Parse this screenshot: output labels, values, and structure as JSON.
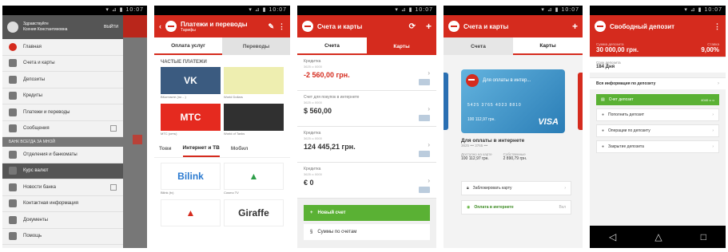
{
  "screen1": {
    "status": "▾ ⊿ ▮ 10:07",
    "profile": {
      "greeting": "Здравствуйте",
      "name": "Ксения Константиновна",
      "menu_label": "ВЫЙТИ"
    },
    "items": [
      {
        "icon": "bank-logo-icon",
        "label": "Главная"
      },
      {
        "icon": "cards-icon",
        "label": "Счета и карты"
      },
      {
        "icon": "deposits-icon",
        "label": "Депозиты"
      },
      {
        "icon": "credits-icon",
        "label": "Кредиты"
      },
      {
        "icon": "payments-icon",
        "label": "Платежи и переводы"
      },
      {
        "icon": "messages-icon",
        "label": "Сообщения"
      }
    ],
    "section": "БАНК ВСЕГДА ЗА МНОЙ",
    "items2": [
      {
        "icon": "branches-icon",
        "label": "Отделения и банкоматы"
      },
      {
        "icon": "exchange-icon",
        "label": "Курс валют"
      },
      {
        "icon": "news-icon",
        "label": "Новости банка"
      },
      {
        "icon": "info-icon",
        "label": "Контактная информация"
      },
      {
        "icon": "docs-icon",
        "label": "Документы"
      },
      {
        "icon": "help-icon",
        "label": "Помощь"
      }
    ]
  },
  "screen2": {
    "status": "▾ ⊿ ▮ 10:07",
    "title": "Платежи и переводы",
    "subtitle": "Тарифы",
    "tabs": [
      "Оплата услуг",
      "Переводы"
    ],
    "section": "ЧАСТЫЕ ПЛАТЕЖИ",
    "tiles": [
      {
        "label": "VK",
        "caption": "ВКонтакте (по ...)",
        "color": "#3b5b80",
        "fg": "#ffffff"
      },
      {
        "label": "",
        "caption": "World Dollars",
        "color": "#eeeeb0",
        "fg": "#666600"
      },
      {
        "label": "МТС",
        "caption": "МТС (сеть)",
        "color": "#e52a1f",
        "fg": "#ffffff"
      },
      {
        "label": "",
        "caption": "World of Tanks",
        "color": "#303030",
        "fg": "#cccccc"
      }
    ],
    "cat_tabs": [
      "Тови",
      "Интернет и ТВ",
      "Мобил"
    ],
    "providers": [
      {
        "label": "Bilink",
        "caption": "Bilink (tv)",
        "color": "#ffffff",
        "fg": "#2b7ad0"
      },
      {
        "label": "▲",
        "caption": "Cosmo TV",
        "color": "#ffffff",
        "fg": "#2e9e49"
      },
      {
        "label": "▲",
        "caption": "",
        "color": "#ffffff",
        "fg": "#d52b1e"
      },
      {
        "label": "Giraffe",
        "caption": "",
        "color": "#ffffff",
        "fg": "#333333"
      }
    ]
  },
  "screen3": {
    "status": "▾ ⊿ ▮ 10:07",
    "title": "Счета и карты",
    "tabs": [
      "Счета",
      "Карты"
    ],
    "accounts": [
      {
        "label": "Кредитка",
        "sub": "3625 •• 0000",
        "value": "-2 560,00 грн.",
        "neg": true
      },
      {
        "label": "Счет для покупок в интернете",
        "sub": "3625 •• 0000",
        "value": "$ 560,00",
        "neg": false
      },
      {
        "label": "Кредитка",
        "sub": "3625 •• 0000",
        "value": "124 445,21 грн.",
        "neg": false
      },
      {
        "label": "Кредитка",
        "sub": "3625 •• 0000",
        "value": "€ 0",
        "neg": false
      }
    ],
    "new_btn": "Новый счет",
    "link": "Суммы по счетам"
  },
  "screen4": {
    "status": "▾ ⊿ ▮ 10:07",
    "title": "Счета и карты",
    "tabs": [
      "Счета",
      "Карты"
    ],
    "card_title": "Для оплаты в интер...",
    "card_number": "5425  3765  4023  8810",
    "card_sub": "100 112,97 грн.",
    "brand": "VISA",
    "name": "Для оплаты в интернете",
    "name_sub": "3625 ••• 3765 •••",
    "left_k": "Доступно на карте",
    "left_v": "100 112,97 грн.",
    "right_k": "Собственные",
    "right_v": "2 890,79 грн.",
    "lock_btn": "Заблокировать карту",
    "online_btn": "Оплата в интернете",
    "online_state": "Вкл"
  },
  "screen5": {
    "status": "▾ ⊿ ▮ 10:07",
    "title": "Свободный депозит",
    "sum_k": "Сумма депозита",
    "sum_v": "30 000,00 грн.",
    "rate_k": "Ставка",
    "rate_v": "9,00%",
    "term_k": "Срок депозита",
    "term_v": "184 Дня",
    "info": "Вся информация по депозиту",
    "actions": [
      {
        "icon": "account-icon",
        "label": "Счет депозит",
        "green": true,
        "right": "4040 •• ••"
      },
      {
        "icon": "plus-icon",
        "label": "Пополнить депозит",
        "green": false,
        "right": ""
      },
      {
        "icon": "operations-icon",
        "label": "Операции по депозиту",
        "green": false,
        "right": ""
      },
      {
        "icon": "close-icon",
        "label": "Закрытие депозита",
        "green": false,
        "right": ""
      }
    ],
    "nav": [
      "◁",
      "△",
      "□"
    ]
  }
}
